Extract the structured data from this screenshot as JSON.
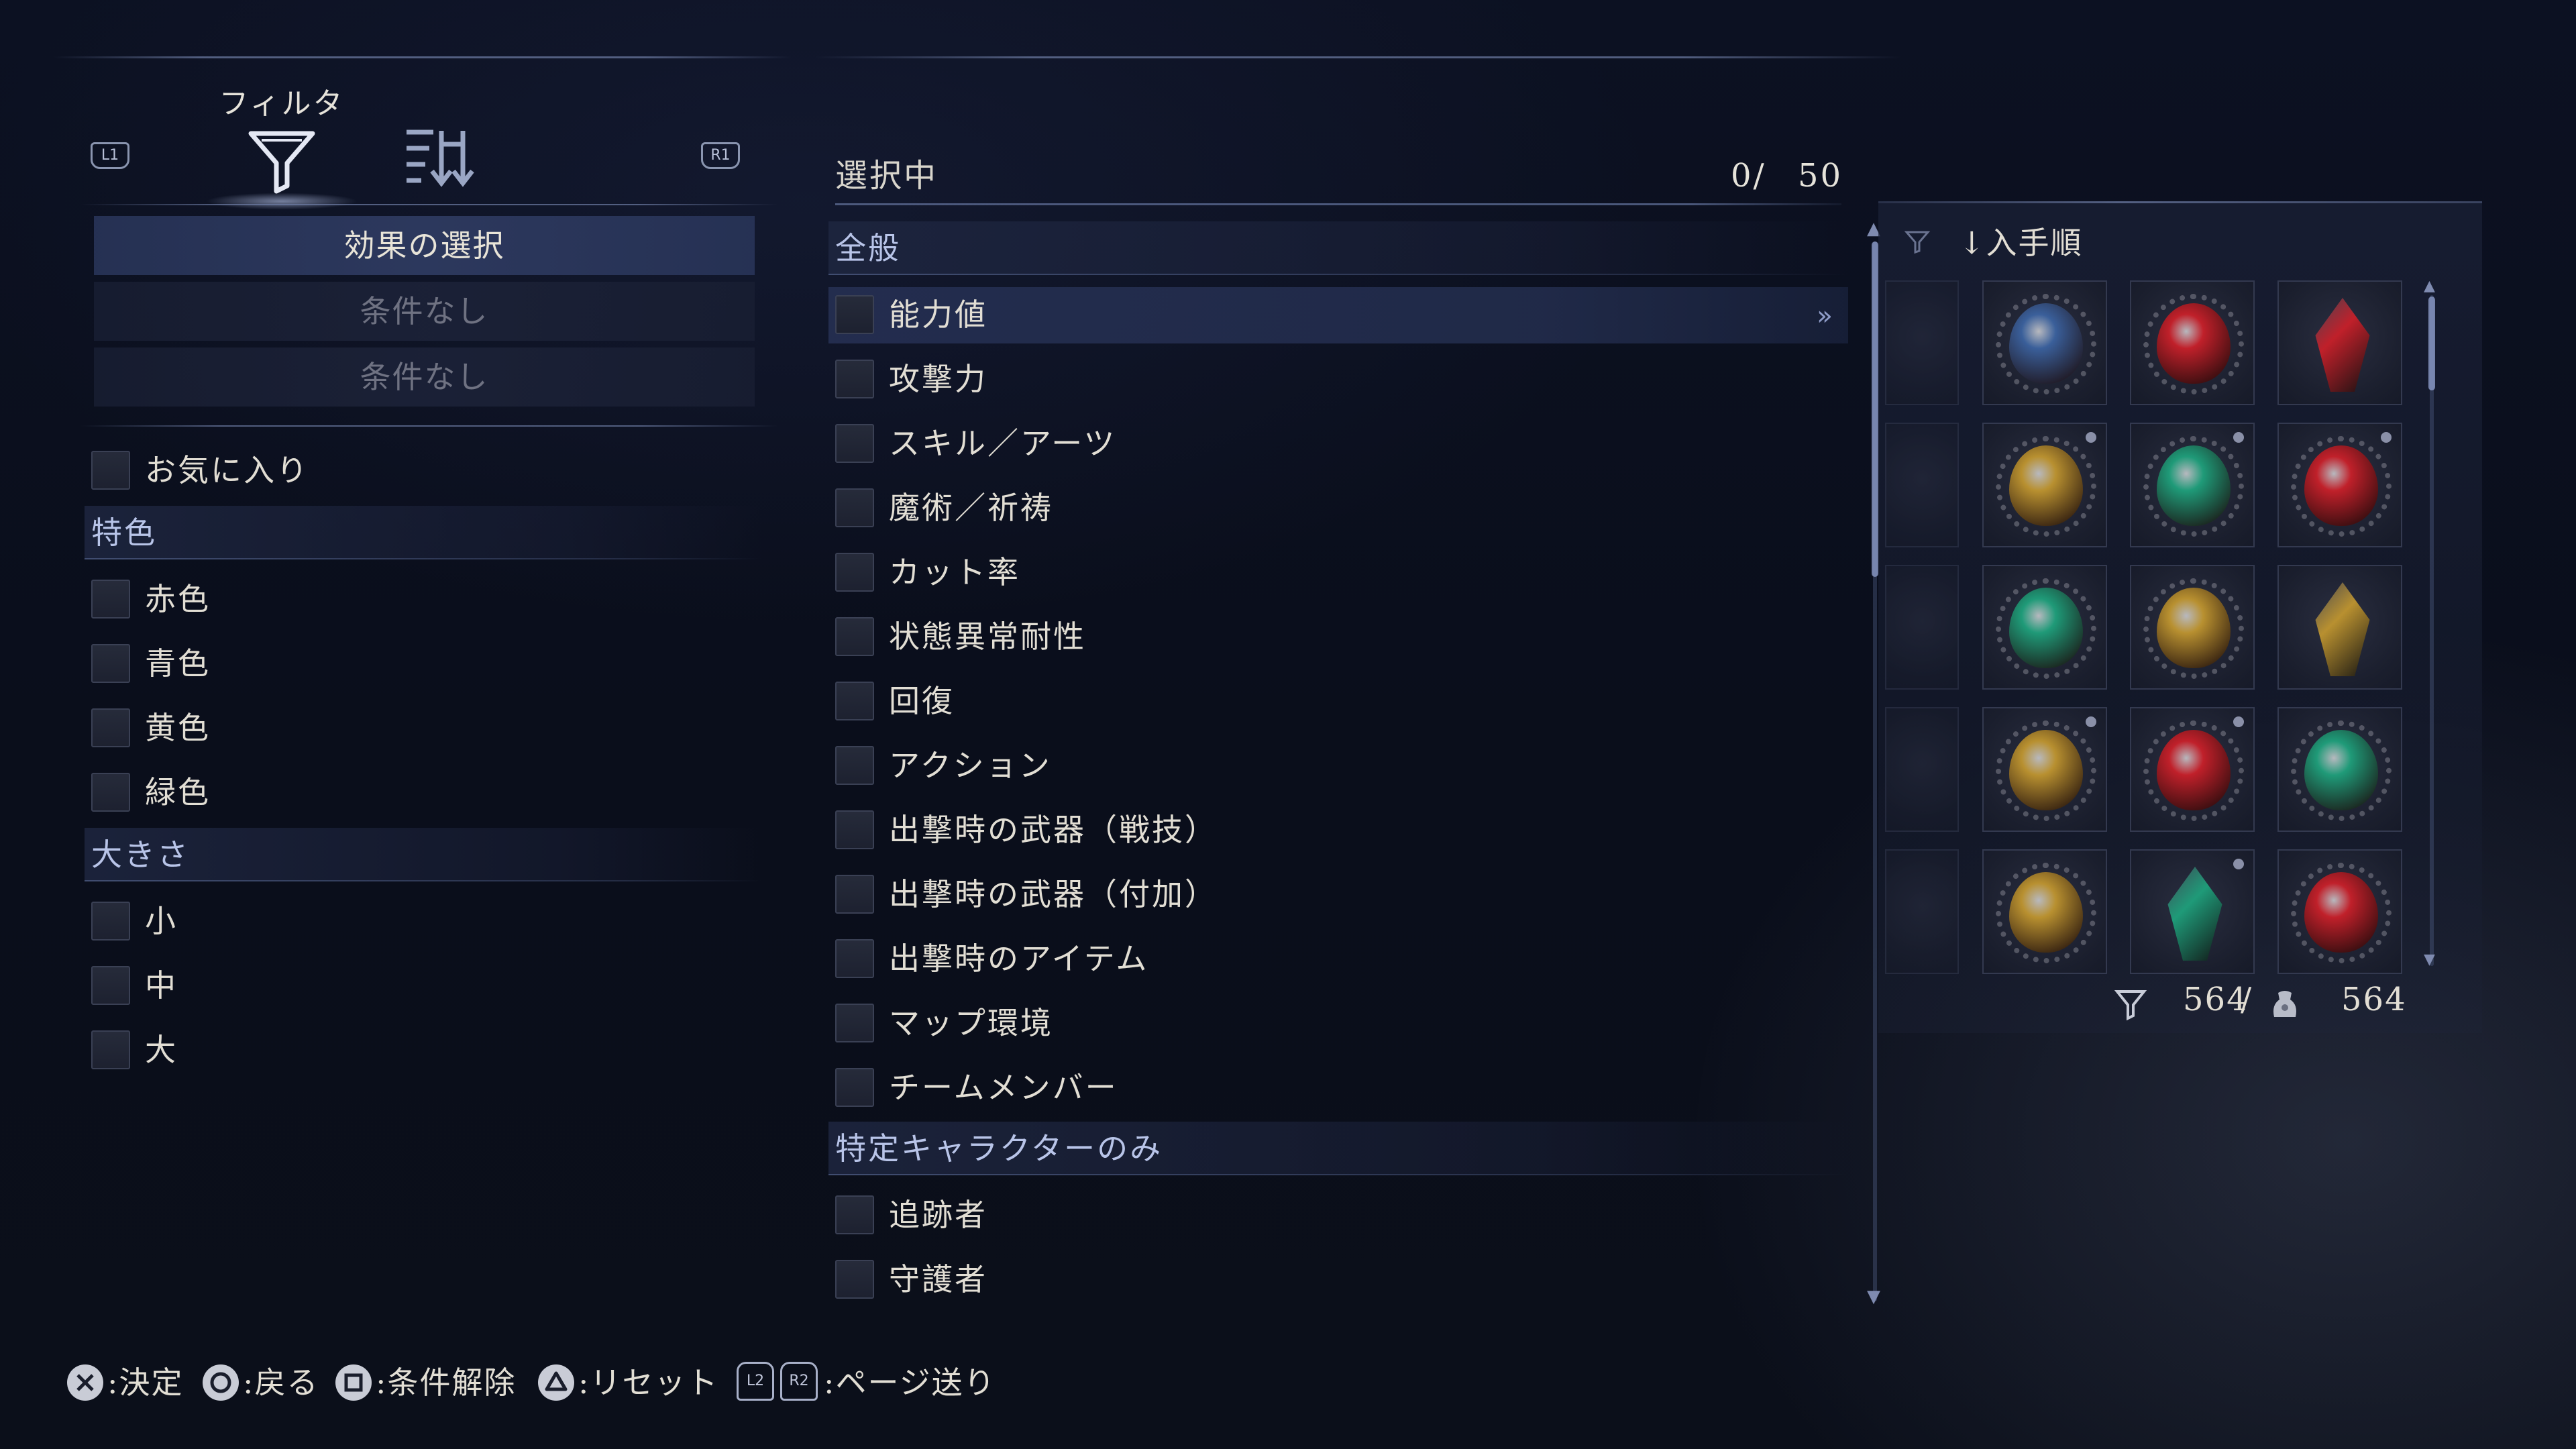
{
  "filter_tabs": {
    "active_title": "フィルタ",
    "left_shoulder": "L1",
    "right_shoulder": "R1"
  },
  "left_panel": {
    "effect_select": "効果の選択",
    "condition_1": "条件なし",
    "condition_2": "条件なし",
    "favorite": "お気に入り",
    "color_section": "特色",
    "colors": [
      "赤色",
      "青色",
      "黄色",
      "緑色"
    ],
    "size_section": "大きさ",
    "sizes": [
      "小",
      "中",
      "大"
    ]
  },
  "middle_panel": {
    "selected_label": "選択中",
    "selected_count": "0/",
    "selected_max": "50",
    "general_section": "全般",
    "general_items": [
      "能力値",
      "攻撃力",
      "スキル／アーツ",
      "魔術／祈祷",
      "カット率",
      "状態異常耐性",
      "回復",
      "アクション",
      "出撃時の武器（戦技）",
      "出撃時の武器（付加）",
      "出撃時のアイテム",
      "マップ環境",
      "チームメンバー"
    ],
    "character_section": "特定キャラクターのみ",
    "character_items": [
      "追跡者",
      "守護者"
    ],
    "scroll_position": 0.0
  },
  "right_panel": {
    "sort_label": "↓入手順",
    "filtered_count": "564",
    "separator": "/",
    "total_count": "564",
    "grid": [
      [
        "blue",
        "red",
        "red-crystal"
      ],
      [
        "yellow",
        "green",
        "red"
      ],
      [
        "green",
        "yellow",
        "yellow-crystal"
      ],
      [
        "yellow",
        "red",
        "green"
      ],
      [
        "yellow",
        "green-crystal",
        "red"
      ]
    ],
    "colors": {
      "red": "#c0202a",
      "blue": "#3a5f9a",
      "yellow": "#b89030",
      "green": "#1f9a78"
    }
  },
  "hints": {
    "confirm": ":決定",
    "back": ":戻る",
    "clear": ":条件解除",
    "reset": ":リセット",
    "page_l": "L2",
    "page_r": "R2",
    "page": ":ページ送り"
  }
}
